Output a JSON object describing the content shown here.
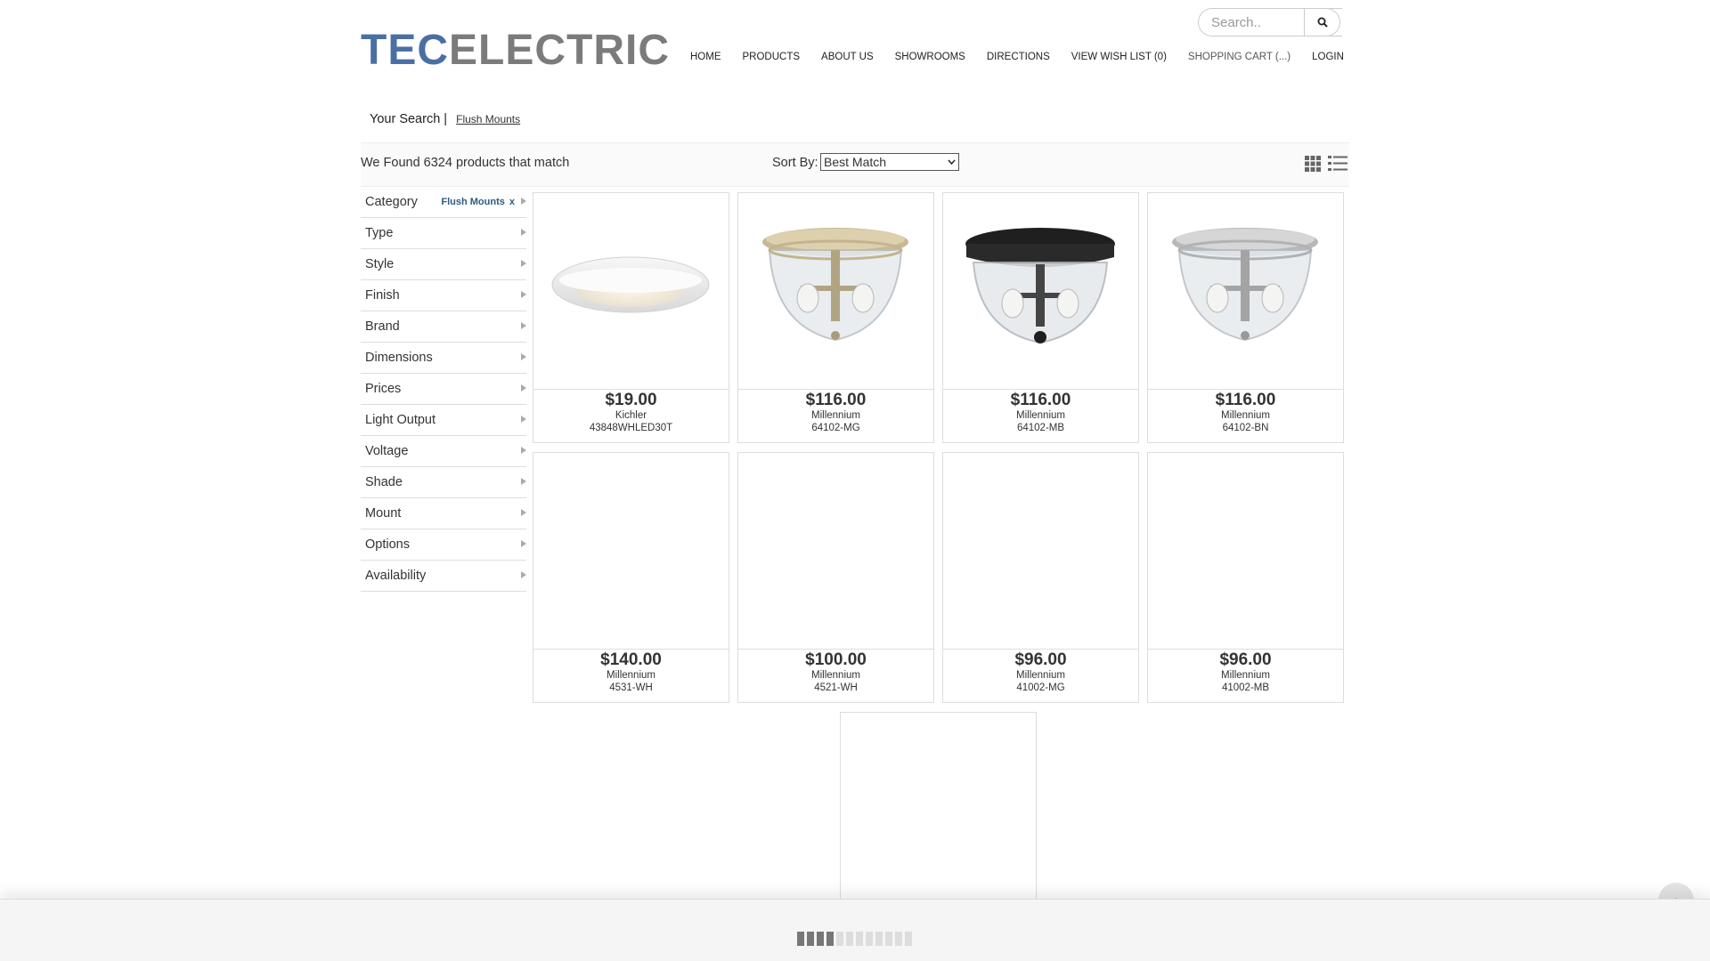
{
  "header": {
    "logo_part1": "TEC",
    "logo_part2": "ELECTRIC",
    "search_placeholder": "Search..",
    "nav": [
      "HOME",
      "PRODUCTS",
      "ABOUT US",
      "SHOWROOMS",
      "DIRECTIONS",
      "VIEW WISH LIST (0)",
      "SHOPPING CART (...)",
      "LOGIN"
    ]
  },
  "breadcrumb": {
    "label": "Your Search |",
    "term": "Flush Mounts"
  },
  "results": {
    "found_text": "We Found 6324 products that match",
    "sort_label": "Sort By:",
    "sort_value": "Best Match"
  },
  "filters": [
    {
      "label": "Category",
      "chip": "Flush Mounts",
      "chip_x": "x"
    },
    {
      "label": "Type"
    },
    {
      "label": "Style"
    },
    {
      "label": "Finish"
    },
    {
      "label": "Brand"
    },
    {
      "label": "Dimensions"
    },
    {
      "label": "Prices"
    },
    {
      "label": "Light Output"
    },
    {
      "label": "Voltage"
    },
    {
      "label": "Shade"
    },
    {
      "label": "Mount"
    },
    {
      "label": "Options"
    },
    {
      "label": "Availability"
    }
  ],
  "products": [
    {
      "price": "$19.00",
      "brand": "Kichler",
      "sku": "43848WHLED30T",
      "image": "disc-light"
    },
    {
      "price": "$116.00",
      "brand": "Millennium",
      "sku": "64102-MG",
      "image": "brass-glass"
    },
    {
      "price": "$116.00",
      "brand": "Millennium",
      "sku": "64102-MB",
      "image": "black-glass"
    },
    {
      "price": "$116.00",
      "brand": "Millennium",
      "sku": "64102-BN",
      "image": "nickel-glass"
    },
    {
      "price": "$140.00",
      "brand": "Millennium",
      "sku": "4531-WH",
      "image": ""
    },
    {
      "price": "$100.00",
      "brand": "Millennium",
      "sku": "4521-WH",
      "image": ""
    },
    {
      "price": "$96.00",
      "brand": "Millennium",
      "sku": "41002-MG",
      "image": ""
    },
    {
      "price": "$96.00",
      "brand": "Millennium",
      "sku": "41002-MB",
      "image": ""
    },
    {
      "price": "",
      "brand": "",
      "sku": "",
      "image": ""
    }
  ],
  "loader": {
    "segments": 12,
    "active": 4
  },
  "colors": {
    "logo_blue": "#4a6fa5",
    "logo_gray": "#7b7b7b",
    "chip_blue": "#2d5b7b"
  }
}
